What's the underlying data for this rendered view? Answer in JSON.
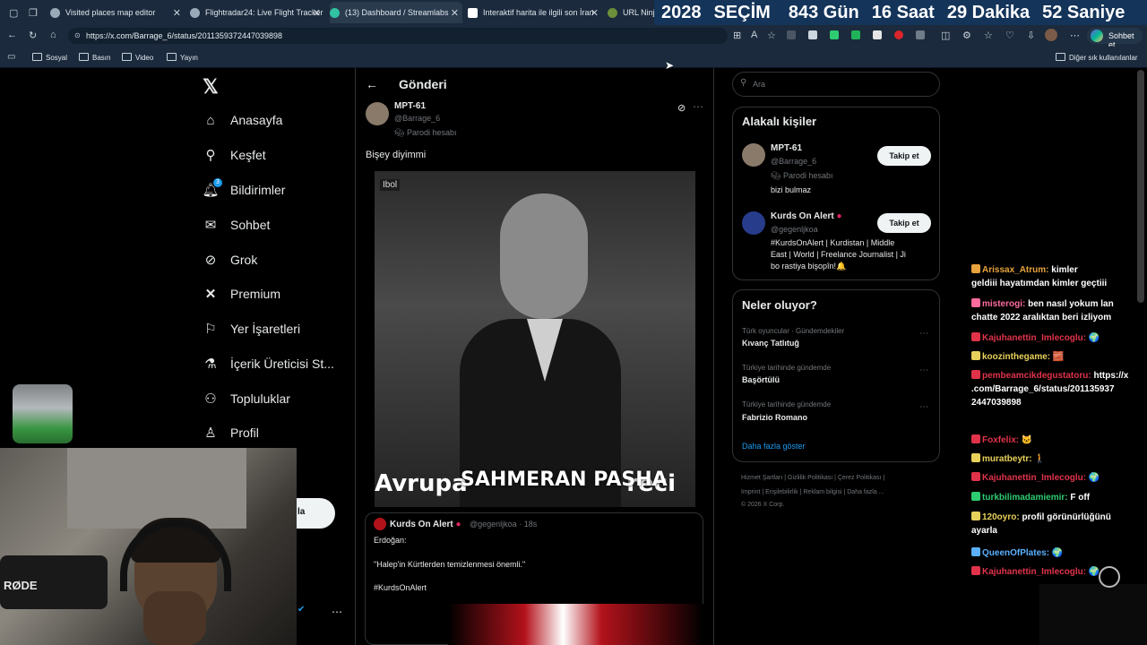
{
  "browser": {
    "tabs": [
      {
        "label": "Visited places map editor"
      },
      {
        "label": "Flightradar24: Live Flight Tracker"
      },
      {
        "label": "(13) Dashboard / Streamlabs"
      },
      {
        "label": "Interaktif harita ile ilgili son İran"
      },
      {
        "label": "URL Ninja"
      }
    ],
    "countdown": {
      "year": "2028",
      "label": "SEÇİM",
      "days": "843 Gün",
      "hours": "16 Saat",
      "minutes": "29 Dakika",
      "seconds": "52 Saniye"
    },
    "url": "https://x.com/Barrage_6/status/2011359372447039898",
    "chat_button": "Sohbet et",
    "bookmarks": [
      "Sosyal",
      "Basın",
      "Video",
      "Yayın"
    ],
    "other_bookmarks": "Diğer sık kullanılanlar"
  },
  "sidebar": {
    "notif_badge": "3",
    "items": [
      {
        "label": "Anasayfa"
      },
      {
        "label": "Keşfet"
      },
      {
        "label": "Bildirimler"
      },
      {
        "label": "Sohbet"
      },
      {
        "label": "Grok"
      },
      {
        "label": "Premium"
      },
      {
        "label": "Yer İşaretleri"
      },
      {
        "label": "İçerik Üreticisi St..."
      },
      {
        "label": "Topluluklar"
      },
      {
        "label": "Profil"
      }
    ],
    "post_button_fragment": "la"
  },
  "post": {
    "header": "Gönderi",
    "author_name": "MPT-61",
    "author_handle": "@Barrage_6",
    "author_badge": "Parodi hesabı",
    "text": "Bişey diyimmi",
    "video_watermark": "Ibol",
    "video_caption_back": "Avrupa",
    "video_caption_end": "reci",
    "video_caption": "SAHMERAN PASHA"
  },
  "quoted": {
    "author_name": "Kurds On Alert",
    "author_handle": "@gegenljkoa",
    "time": "18s",
    "line1": "Erdoğan:",
    "line2": "\"Halep'in Kürtlerden temizlenmesi önemli.\"",
    "hashtag": "#KurdsOnAlert"
  },
  "right": {
    "search_placeholder": "Ara",
    "related_title": "Alakalı kişiler",
    "people": [
      {
        "name": "MPT-61",
        "handle": "@Barrage_6",
        "badge": "Parodi hesabı",
        "bio": "bizi bulmaz",
        "follow": "Takip et"
      },
      {
        "name": "Kurds On Alert",
        "handle": "@gegenljkoa",
        "bio1": "#KurdsOnAlert | Kurdistan | Middle",
        "bio2": "East | World | Freelance Journalist | Ji",
        "bio3": "bo rastiya bişopîn!🔔",
        "follow": "Takip et"
      }
    ],
    "trends_title": "Neler oluyor?",
    "trends": [
      {
        "category": "Türk oyuncular · Gündemdekiler",
        "name": "Kıvanç Tatlıtuğ"
      },
      {
        "category": "Türkiye tarihinde gündemde",
        "name": "Başörtülü"
      },
      {
        "category": "Türkiye tarihinde gündemde",
        "name": "Fabrizio Romano"
      }
    ],
    "show_more": "Daha fazla göster",
    "footer1": "Hizmet Şartları  |  Gizlilik Politikası  |  Çerez Politikası  |",
    "footer2": "Imprint  |  Erişilebilirlik  |  Reklam bilgisi  |  Daha fazla ...",
    "footer3": "© 2026 X Corp."
  },
  "chat": [
    {
      "user": "Arissax_Atrum:",
      "msg": "kimler",
      "msg2": "geldiii hayatımdan kimler geçtiii",
      "color": "#e8a33c"
    },
    {
      "user": "misterogi:",
      "msg": "ben nasıl yokum lan",
      "msg2": "chatte 2022 aralıktan beri izliyom",
      "color": "#ff6b9e"
    },
    {
      "user": "Kajuhanettin_Imlecoglu:",
      "msg": "🌍",
      "color": "#e0334a"
    },
    {
      "user": "koozinthegame:",
      "msg": "🧱",
      "color": "#e8d15a"
    },
    {
      "user": "pembeamcikdegustatoru:",
      "msg": "https://x",
      "msg2": ".com/Barrage_6/status/201135937",
      "msg3": "2447039898",
      "color": "#e0334a"
    },
    {
      "user": "Foxfelix:",
      "msg": "🐱",
      "color": "#e0334a"
    },
    {
      "user": "muratbeytr:",
      "msg": "🚶",
      "color": "#e8d15a"
    },
    {
      "user": "Kajuhanettin_Imlecoglu:",
      "msg": "🌍",
      "color": "#e0334a"
    },
    {
      "user": "turkbilimadamiemir:",
      "msg": "F off",
      "color": "#2ecc71"
    },
    {
      "user": "120oyro:",
      "msg": "profil görünürlüğünü",
      "msg2": "ayarla",
      "color": "#e8d15a"
    },
    {
      "user": "QueenOfPlates:",
      "msg": "🌍",
      "color": "#5ab0ff"
    },
    {
      "user": "Kajuhanettin_Imlecoglu:",
      "msg": "🌍",
      "color": "#e0334a"
    }
  ],
  "webcam": {
    "mic_brand": "RØDE"
  },
  "colors": {
    "accent": "#1d9bf0",
    "browser_chrome": "#1b2a3c",
    "countdown_bg": "#14345a"
  }
}
